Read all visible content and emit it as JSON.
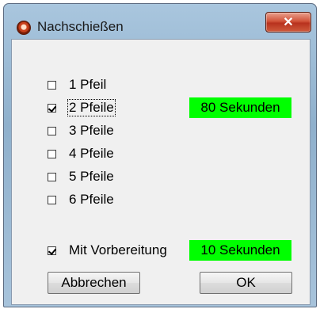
{
  "window": {
    "title": "Nachschießen",
    "close_label": "✕"
  },
  "arrows": [
    {
      "label": "1 Pfeil",
      "checked": false
    },
    {
      "label": "2 Pfeile",
      "checked": true
    },
    {
      "label": "3 Pfeile",
      "checked": false
    },
    {
      "label": "4 Pfeile",
      "checked": false
    },
    {
      "label": "5 Pfeile",
      "checked": false
    },
    {
      "label": "6 Pfeile",
      "checked": false
    }
  ],
  "arrow_time_label": "80 Sekunden",
  "preparation": {
    "label": "Mit Vorbereitung",
    "checked": true
  },
  "preparation_time_label": "10 Sekunden",
  "buttons": {
    "cancel_label": "Abbrechen",
    "ok_label": "OK"
  },
  "colors": {
    "badge": "#00ff00",
    "close_button": "#c8402a"
  }
}
